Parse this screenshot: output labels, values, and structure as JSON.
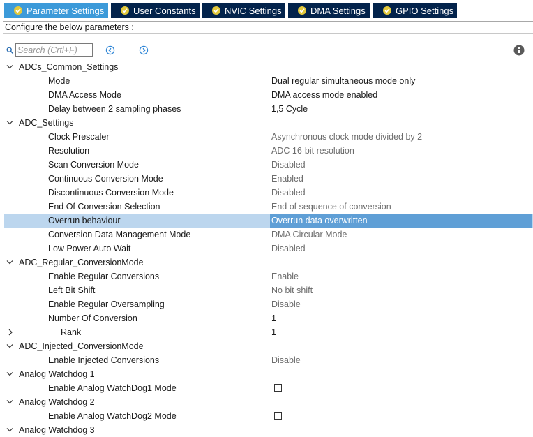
{
  "tabs": [
    {
      "label": "Parameter Settings",
      "active": true
    },
    {
      "label": "User Constants",
      "active": false
    },
    {
      "label": "NVIC Settings",
      "active": false
    },
    {
      "label": "DMA Settings",
      "active": false
    },
    {
      "label": "GPIO Settings",
      "active": false
    }
  ],
  "description": "Configure the below parameters :",
  "search": {
    "placeholder": "Search (Crtl+F)"
  },
  "groups": {
    "common": {
      "label": "ADCs_Common_Settings"
    },
    "adc": {
      "label": "ADC_Settings"
    },
    "regular": {
      "label": "ADC_Regular_ConversionMode"
    },
    "injected": {
      "label": "ADC_Injected_ConversionMode"
    },
    "wd1": {
      "label": "Analog Watchdog 1"
    },
    "wd2": {
      "label": "Analog Watchdog 2"
    },
    "wd3": {
      "label": "Analog Watchdog 3"
    }
  },
  "params": {
    "mode": {
      "label": "Mode",
      "value": "Dual regular simultaneous mode only"
    },
    "dma_access": {
      "label": "DMA Access Mode",
      "value": "DMA access mode enabled"
    },
    "delay": {
      "label": "Delay between 2 sampling phases",
      "value": "1,5 Cycle"
    },
    "clock": {
      "label": "Clock Prescaler",
      "value": "Asynchronous clock mode divided by 2"
    },
    "resolution": {
      "label": "Resolution",
      "value": "ADC 16-bit resolution"
    },
    "scan": {
      "label": "Scan Conversion Mode",
      "value": "Disabled"
    },
    "continuous": {
      "label": "Continuous Conversion Mode",
      "value": "Enabled"
    },
    "discontinuous": {
      "label": "Discontinuous Conversion Mode",
      "value": "Disabled"
    },
    "eoc": {
      "label": "End Of Conversion Selection",
      "value": "End of sequence of conversion"
    },
    "overrun": {
      "label": "Overrun behaviour",
      "value": "Overrun data overwritten"
    },
    "data_mgmt": {
      "label": "Conversion Data Management Mode",
      "value": "DMA Circular Mode"
    },
    "low_power": {
      "label": "Low Power Auto Wait",
      "value": "Disabled"
    },
    "enable_regular": {
      "label": "Enable Regular Conversions",
      "value": "Enable"
    },
    "left_shift": {
      "label": "Left Bit Shift",
      "value": "No bit shift"
    },
    "oversampling": {
      "label": "Enable Regular Oversampling",
      "value": "Disable"
    },
    "num_conv": {
      "label": "Number Of Conversion",
      "value": "1"
    },
    "rank": {
      "label": "Rank",
      "value": "1"
    },
    "enable_injected": {
      "label": "Enable Injected Conversions",
      "value": "Disable"
    },
    "wd1_mode": {
      "label": "Enable Analog WatchDog1 Mode",
      "checked": false
    },
    "wd2_mode": {
      "label": "Enable Analog WatchDog2 Mode",
      "checked": false
    }
  },
  "colors": {
    "tab_bg": "#03234b",
    "tab_active": "#3c9ad9",
    "check": "#e3c93c",
    "selection": "#bcd6ee"
  }
}
